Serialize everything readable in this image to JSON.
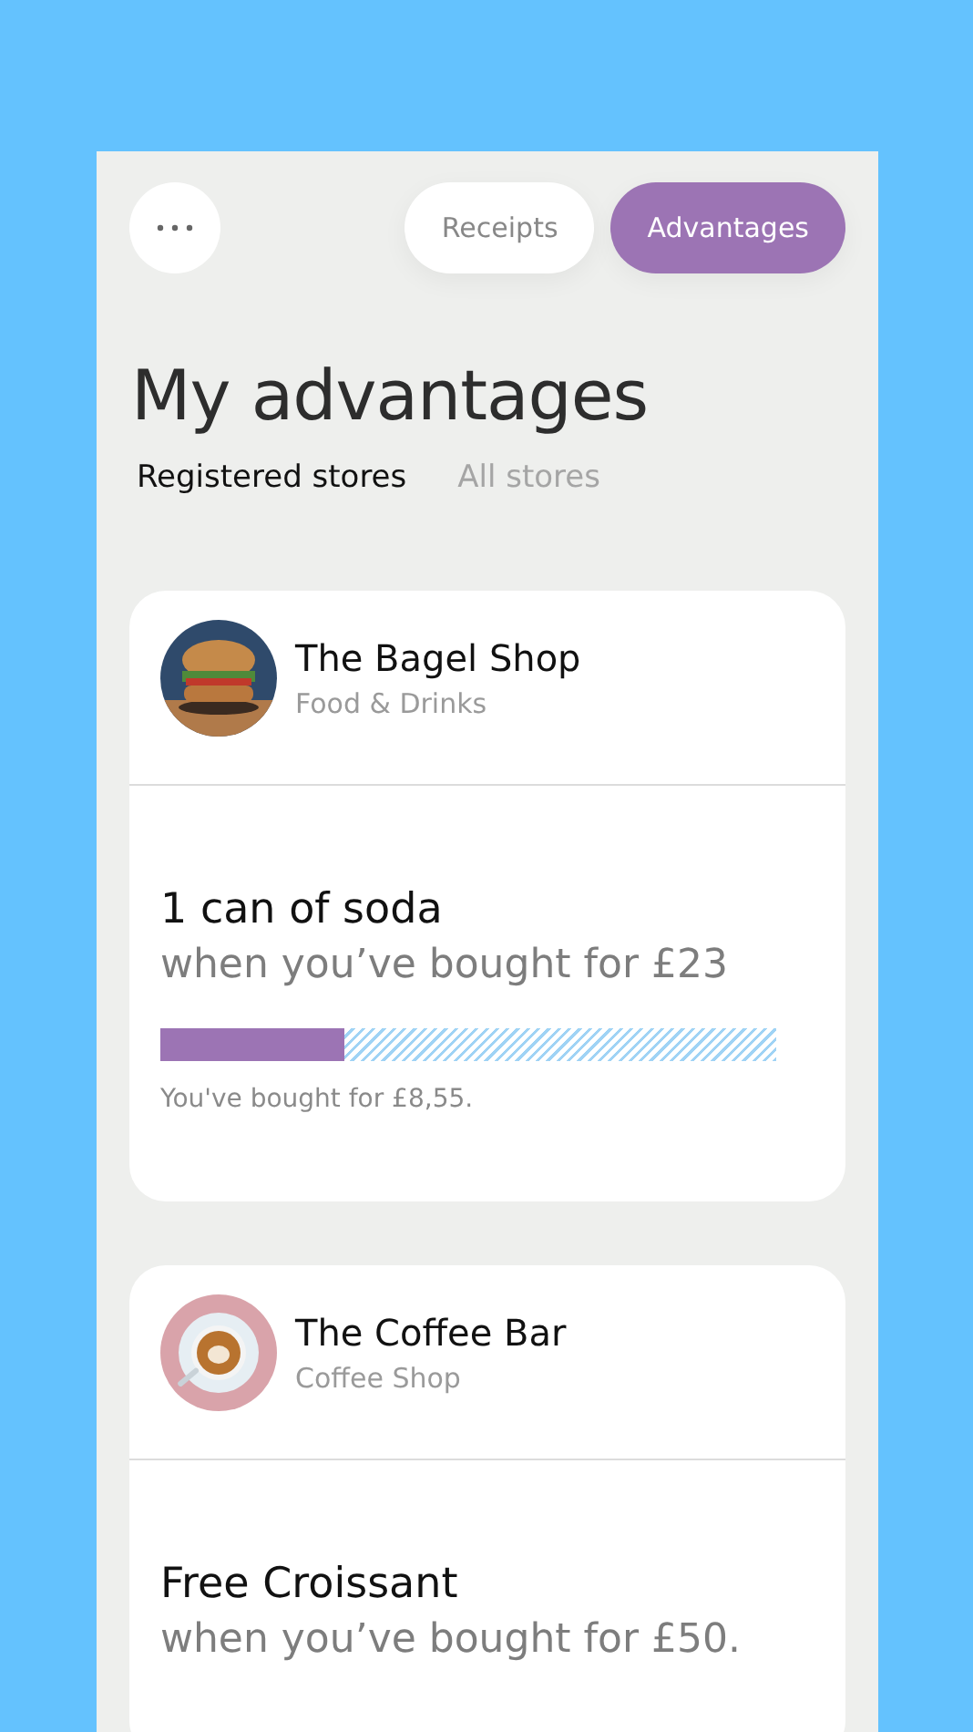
{
  "tabs": [
    {
      "label": "Receipts",
      "selected": false
    },
    {
      "label": "Advantages",
      "selected": true
    }
  ],
  "title": "My advantages",
  "filters": [
    {
      "label": "Registered stores",
      "selected": true
    },
    {
      "label": "All stores",
      "selected": false
    }
  ],
  "stores": [
    {
      "name": "The Bagel Shop",
      "category": "Food & Drinks",
      "offer": "1 can of soda",
      "condition": "when you’ve bought for £23",
      "level": 0.3,
      "progress_note": "You've bought for £8,55."
    },
    {
      "name": "The Coffee Bar",
      "category": "Coffee Shop",
      "offer": "Free Croissant",
      "condition": "when you’ve bought for £50."
    }
  ]
}
